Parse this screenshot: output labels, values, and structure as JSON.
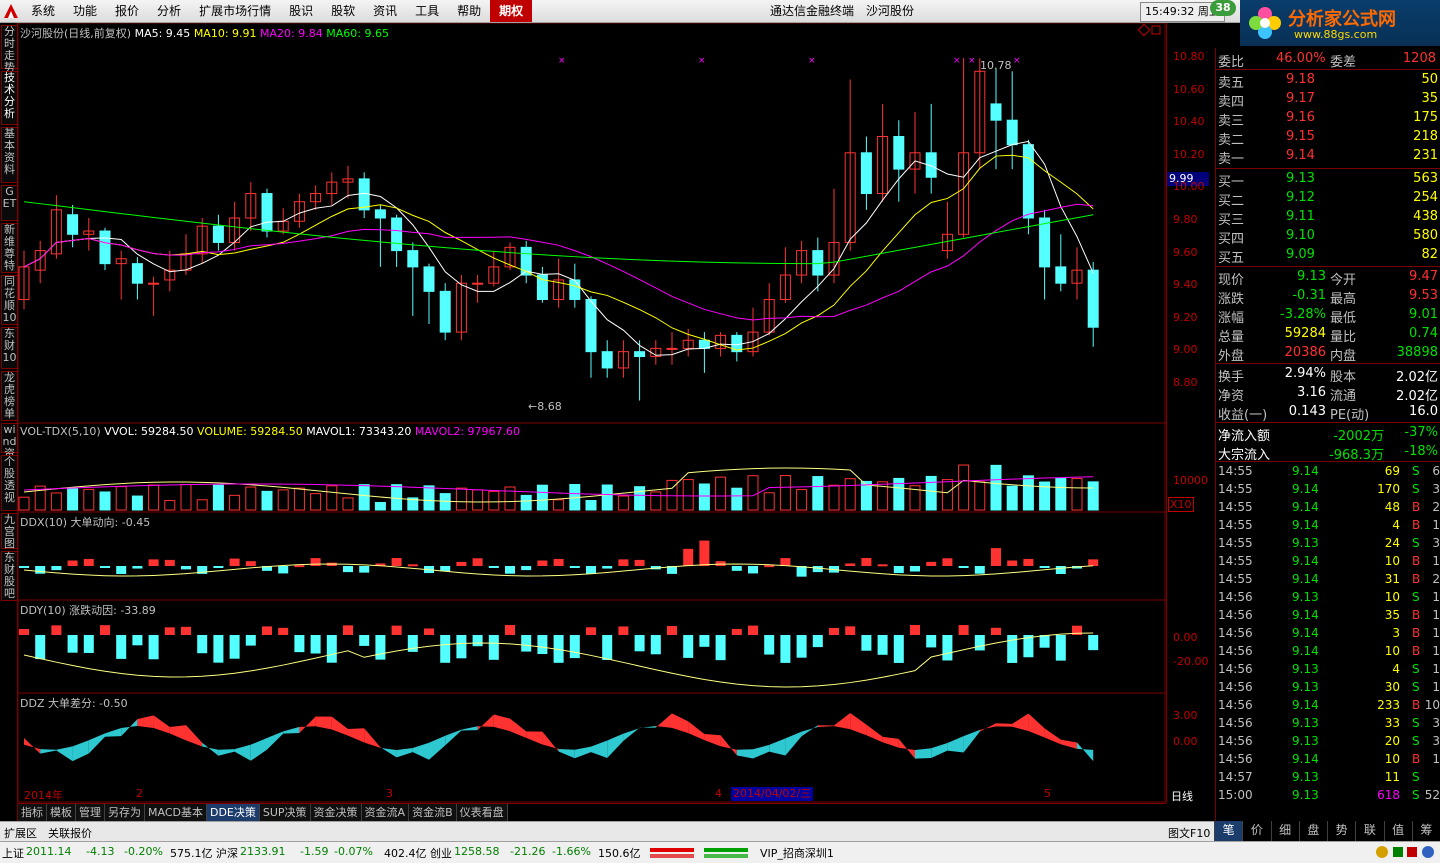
{
  "menu": {
    "items": [
      "系统",
      "功能",
      "报价",
      "分析",
      "扩展市场行情",
      "股识",
      "股软",
      "资讯",
      "工具",
      "帮助"
    ],
    "highlight": "期权",
    "title": "通达信金融终端",
    "stock": "沙河股份",
    "time": "15:49:32 周五",
    "badge": "38"
  },
  "brand": {
    "name": "分析家公式网",
    "url": "www.88gs.com"
  },
  "sidebar": [
    "分时走势",
    "技术分析",
    "基本资料",
    "GET",
    "新维尊特",
    "同花顺10",
    "东财10",
    "龙虎榜单",
    "wind资讯",
    "个股透视",
    "九宫图",
    "东财股吧"
  ],
  "main": {
    "title": "沙河股份(日线,前复权)",
    "ma5": "MA5: 9.45",
    "ma10": "MA10: 9.91",
    "ma20": "MA20: 9.84",
    "ma60": "MA60: 9.65",
    "high_label": "10.78",
    "low_label": "8.68",
    "axis": [
      "10.80",
      "10.60",
      "10.40",
      "10.20",
      "10.00",
      "9.80",
      "9.60",
      "9.40",
      "9.20",
      "9.00",
      "8.80"
    ],
    "current": "9.99"
  },
  "vol": {
    "title": "VOL-TDX(5,10)",
    "vvol": "VVOL: 59284.50",
    "volume": "VOLUME: 59284.50",
    "mavol1": "MAVOL1: 73343.20",
    "mavol2": "MAVOL2: 97967.60",
    "axis": "10000",
    "unit": "X10"
  },
  "ddx": {
    "title": "DDX(10) 大单动向: -0.45"
  },
  "ddy": {
    "title": "DDY(10) 涨跌动因: -33.89",
    "axis1": "0.00",
    "axis2": "-20.00"
  },
  "ddz": {
    "title": "DDZ 大单差分: -0.50",
    "axis1": "3.00",
    "axis2": "0.00"
  },
  "xaxis": {
    "labels": [
      "2014年",
      "2",
      "3",
      "4",
      "5"
    ],
    "selected": "2014/04/02/三",
    "period": "日线"
  },
  "tabs": [
    "指标",
    "模板",
    "管理",
    "另存为",
    "MACD基本",
    "DDE决策",
    "SUP决策",
    "资金决策",
    "资金流A",
    "资金流B",
    "仪表看盘"
  ],
  "tabs_active": "DDE决策",
  "quote": {
    "weibi_label": "委比",
    "weibi": "46.00%",
    "weicha_label": "委差",
    "weicha": "1208",
    "asks": [
      [
        "卖五",
        "9.18",
        "50"
      ],
      [
        "卖四",
        "9.17",
        "35"
      ],
      [
        "卖三",
        "9.16",
        "175"
      ],
      [
        "卖二",
        "9.15",
        "218"
      ],
      [
        "卖一",
        "9.14",
        "231"
      ]
    ],
    "bids": [
      [
        "买一",
        "9.13",
        "563"
      ],
      [
        "买二",
        "9.12",
        "254"
      ],
      [
        "买三",
        "9.11",
        "438"
      ],
      [
        "买四",
        "9.10",
        "580"
      ],
      [
        "买五",
        "9.09",
        "82"
      ]
    ],
    "stats": [
      [
        "现价",
        "9.13",
        "今开",
        "9.47"
      ],
      [
        "涨跌",
        "-0.31",
        "最高",
        "9.53"
      ],
      [
        "涨幅",
        "-3.28%",
        "最低",
        "9.01"
      ],
      [
        "总量",
        "59284",
        "量比",
        "0.74"
      ],
      [
        "外盘",
        "20386",
        "内盘",
        "38898"
      ]
    ],
    "stats2": [
      [
        "换手",
        "2.94%",
        "股本",
        "2.02亿"
      ],
      [
        "净资",
        "3.16",
        "流通",
        "2.02亿"
      ],
      [
        "收益(一)",
        "0.143",
        "PE(动)",
        "16.0"
      ]
    ],
    "flow": [
      [
        "净流入额",
        "-2002万",
        "-37%"
      ],
      [
        "大宗流入",
        "-968.3万",
        "-18%"
      ]
    ],
    "ticks": [
      [
        "14:55",
        "9.14",
        "69",
        "S"
      ],
      [
        "14:55",
        "9.14",
        "170",
        "S"
      ],
      [
        "14:55",
        "9.14",
        "48",
        "B"
      ],
      [
        "14:55",
        "9.14",
        "4",
        "B"
      ],
      [
        "14:55",
        "9.13",
        "24",
        "S"
      ],
      [
        "14:55",
        "9.14",
        "10",
        "B"
      ],
      [
        "14:55",
        "9.14",
        "31",
        "B"
      ],
      [
        "14:56",
        "9.13",
        "10",
        "S"
      ],
      [
        "14:56",
        "9.14",
        "35",
        "B"
      ],
      [
        "14:56",
        "9.14",
        "3",
        "B"
      ],
      [
        "14:56",
        "9.14",
        "10",
        "B"
      ],
      [
        "14:56",
        "9.13",
        "4",
        "S"
      ],
      [
        "14:56",
        "9.13",
        "30",
        "S"
      ],
      [
        "14:56",
        "9.14",
        "233",
        "B"
      ],
      [
        "14:56",
        "9.13",
        "33",
        "S"
      ],
      [
        "14:56",
        "9.13",
        "20",
        "S"
      ],
      [
        "14:56",
        "9.14",
        "10",
        "B"
      ],
      [
        "14:57",
        "9.13",
        "11",
        "S"
      ],
      [
        "15:00",
        "9.13",
        "618",
        "S"
      ]
    ],
    "tick_extra": [
      "6",
      "3",
      "2",
      "1",
      "3",
      "1",
      "2",
      "1",
      "1",
      "1",
      "1",
      "1",
      "1",
      "10",
      "3",
      "3",
      "1",
      "",
      ""
    ],
    "last_extra": "52"
  },
  "right_tabs": [
    "笔",
    "价",
    "细",
    "盘",
    "势",
    "联",
    "值",
    "筹"
  ],
  "ext": {
    "a": "扩展区",
    "b": "关联报价",
    "c": "图文F10"
  },
  "status": {
    "sh_label": "上证",
    "sh": "2011.14",
    "sh_chg": "-4.13",
    "sh_pct": "-0.20%",
    "sh_amt": "575.1亿",
    "sz_label": "沪深",
    "sz": "2133.91",
    "sz_chg": "-1.59",
    "sz_pct": "-0.07%",
    "sz_amt": "402.4亿",
    "cy_label": "创业",
    "cy": "1258.58",
    "cy_chg": "-21.26",
    "cy_pct": "-1.66%",
    "cy_amt": "150.6亿",
    "vip": "VIP_招商深圳1"
  }
}
